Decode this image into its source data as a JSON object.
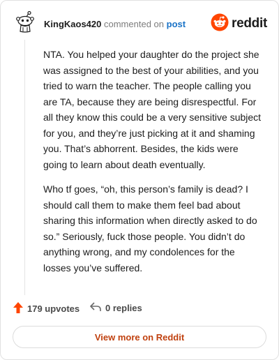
{
  "header": {
    "username": "KingKaos420",
    "action_text": "commented on",
    "link_text": "post",
    "logo_text": "reddit",
    "avatar_icon": "snoo-avatar-icon",
    "logo_icon": "reddit-alien-icon"
  },
  "comment": {
    "paragraphs": [
      "NTA. You helped your daughter do the project she was assigned to the best of your abilities, and you tried to warn the teacher. The people calling you are TA, because they are being disrespectful. For all they know this could be a very sensitive subject for you, and they’re just picking at it and shaming you. That’s abhorrent. Besides, the kids were going to learn about death eventually.",
      "Who tf goes, “oh, this person’s family is dead? I should call them to make them feel bad about sharing this information when directly asked to do so.” Seriously, fuck those people. You didn’t do anything wrong, and my condolences for the losses you’ve suffered."
    ]
  },
  "footer": {
    "upvotes": "179 upvotes",
    "replies": "0 replies",
    "upvote_icon": "upvote-arrow-icon",
    "reply_icon": "reply-arrow-icon"
  },
  "cta": {
    "label": "View more on Reddit"
  },
  "colors": {
    "accent": "#ff4500",
    "link": "#1a73c7",
    "cta_text": "#c0410f"
  }
}
